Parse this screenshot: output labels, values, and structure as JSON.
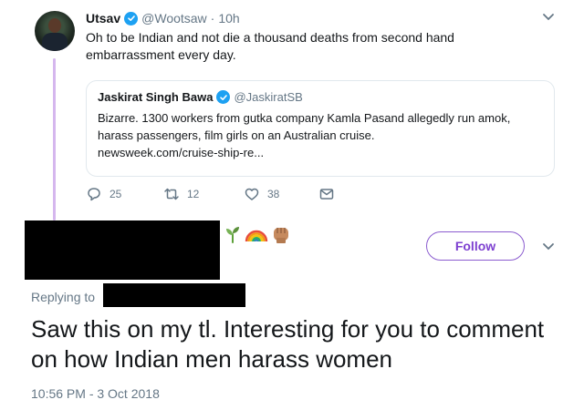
{
  "tweet1": {
    "name": "Utsav",
    "handle": "@Wootsaw",
    "dot": "·",
    "time": "10h",
    "text": "Oh to be Indian and not die a thousand deaths from second hand embarrassment every day.",
    "quoted": {
      "name": "Jaskirat Singh Bawa",
      "handle": "@JaskiratSB",
      "text": "Bizarre. 1300 workers from gutka company Kamla Pasand allegedly run amok, harass passengers, film girls on an Australian cruise.",
      "link": "newsweek.com/cruise-ship-re..."
    },
    "actions": {
      "replies": "25",
      "retweets": "12",
      "likes": "38"
    }
  },
  "tweet2": {
    "emojis": "🌱🌈✊🏽",
    "follow_label": "Follow",
    "replying_label": "Replying to",
    "text": "Saw this on my tl. Interesting for you to comment on how Indian men harass women",
    "timestamp": "10:56 PM - 3 Oct 2018"
  },
  "colors": {
    "verified": "#1da1f2",
    "follow_accent": "#7d3fd0",
    "muted": "#657786",
    "thread_line": "#d5b7ee"
  },
  "icons": [
    "verified-badge-icon",
    "chevron-down-icon",
    "reply-icon",
    "retweet-icon",
    "like-icon",
    "message-icon"
  ]
}
